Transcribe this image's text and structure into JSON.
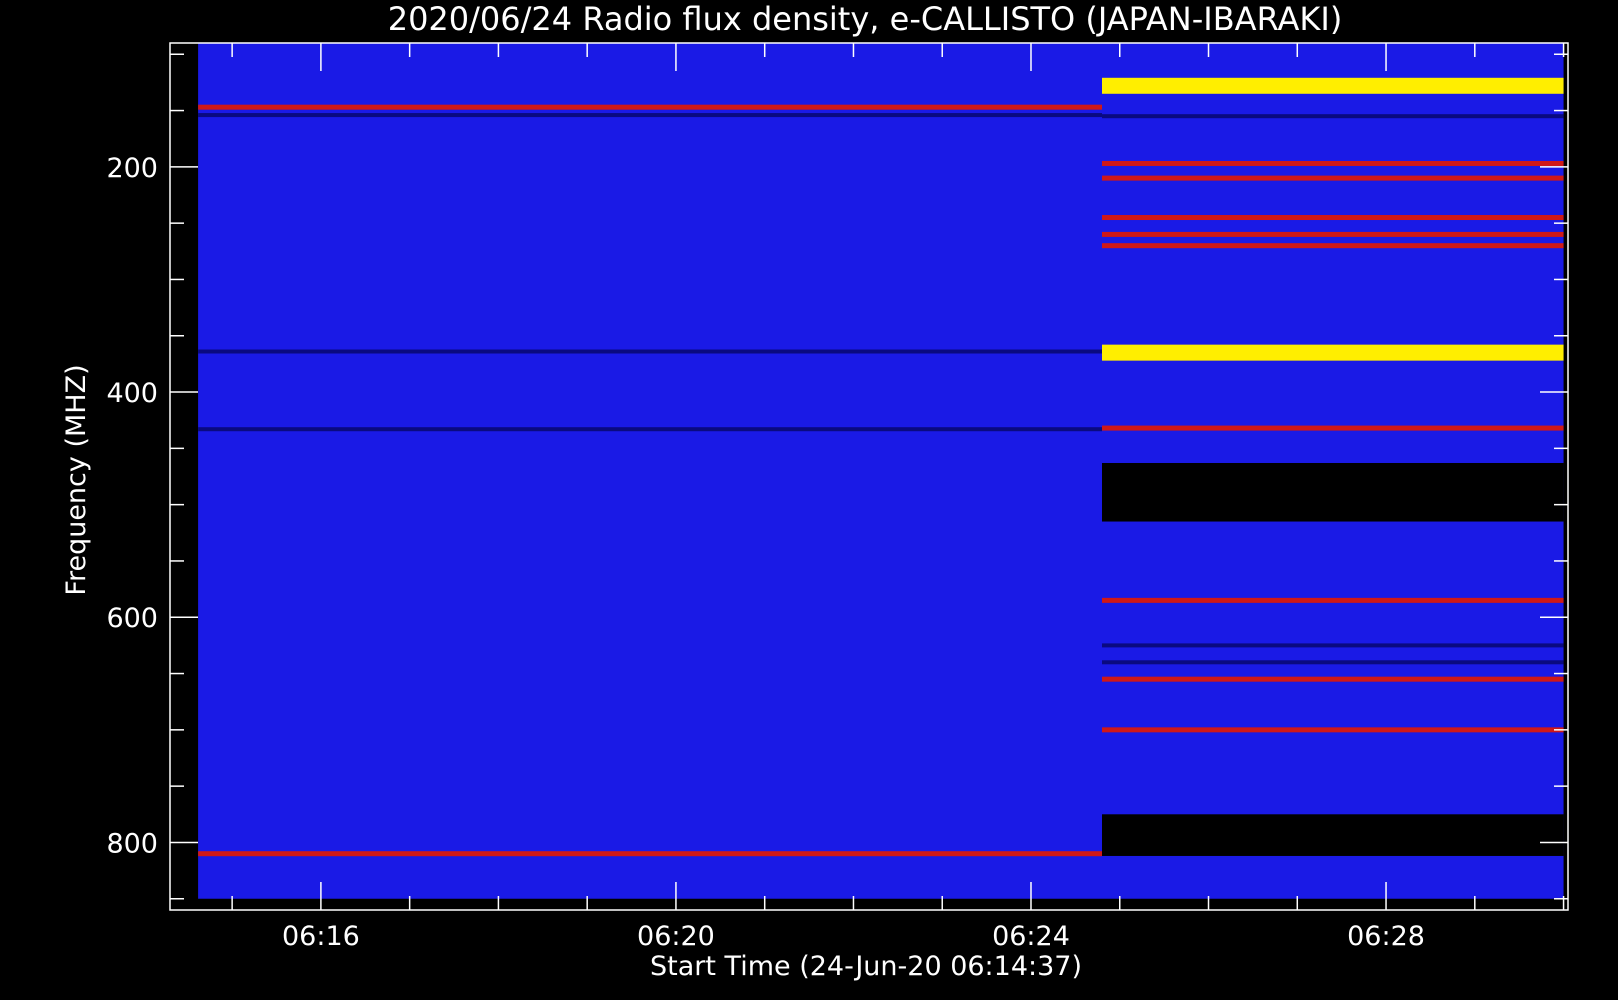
{
  "chart_data": {
    "type": "heatmap",
    "title": "2020/06/24  Radio flux density, e-CALLISTO (JAPAN-IBARAKI)",
    "xlabel": "Start Time (24-Jun-20 06:14:37)",
    "ylabel": "Frequency (MHZ)",
    "x_range": [
      "06:14:37",
      "06:30:00"
    ],
    "ylim": [
      860,
      90
    ],
    "x_ticks": [
      "06:16",
      "06:20",
      "06:24",
      "06:28"
    ],
    "y_ticks": [
      200,
      400,
      600,
      800
    ],
    "colors": {
      "background": "#000000",
      "axis": "#ffffff",
      "low": "#1a1ae6",
      "dark": "#0a0a80",
      "mid": "#d01818",
      "high": "#ffee00"
    },
    "segments": [
      {
        "name": "early",
        "time_start": "06:14:37",
        "time_end": "06:24:48",
        "freq_range": [
          90,
          850
        ],
        "bands": [
          {
            "freq": 147,
            "level": "mid"
          },
          {
            "freq": 154,
            "level": "dark"
          },
          {
            "freq": 364,
            "level": "dark"
          },
          {
            "freq": 433,
            "level": "dark"
          },
          {
            "freq": 810,
            "level": "mid"
          }
        ]
      },
      {
        "name": "late",
        "time_start": "06:24:48",
        "time_end": "06:30:00",
        "freq_range": [
          90,
          850
        ],
        "gaps": [
          [
            463,
            515
          ],
          [
            775,
            812
          ]
        ],
        "bands": [
          {
            "freq": 128,
            "level": "high"
          },
          {
            "freq": 155,
            "level": "dark"
          },
          {
            "freq": 197,
            "level": "mid"
          },
          {
            "freq": 210,
            "level": "mid"
          },
          {
            "freq": 245,
            "level": "mid"
          },
          {
            "freq": 260,
            "level": "mid"
          },
          {
            "freq": 270,
            "level": "mid"
          },
          {
            "freq": 365,
            "level": "high"
          },
          {
            "freq": 432,
            "level": "mid"
          },
          {
            "freq": 585,
            "level": "mid"
          },
          {
            "freq": 625,
            "level": "dark"
          },
          {
            "freq": 640,
            "level": "dark"
          },
          {
            "freq": 655,
            "level": "mid"
          },
          {
            "freq": 700,
            "level": "mid"
          }
        ]
      }
    ]
  }
}
